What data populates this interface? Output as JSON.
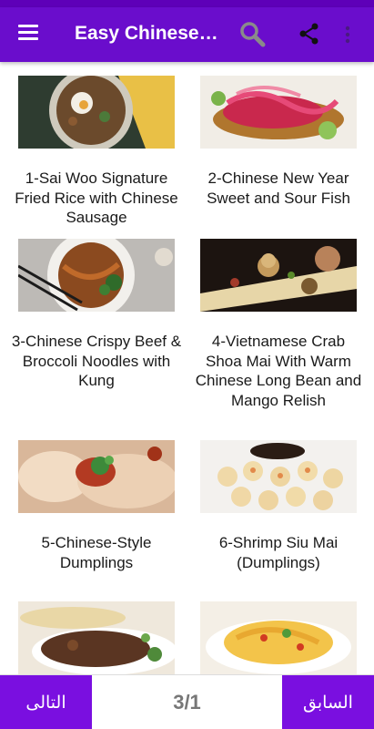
{
  "appbar": {
    "title": "Easy Chinese Recipes",
    "icons": [
      "menu-icon",
      "search-icon",
      "share-icon",
      "more-vert-icon"
    ],
    "color": "#6a0dcc"
  },
  "recipes": [
    {
      "caption": "1-Sai Woo Signature Fried Rice with Chinese Sausage"
    },
    {
      "caption": "2-Chinese New Year Sweet and Sour Fish"
    },
    {
      "caption": "3-Chinese Crispy Beef & Broccoli Noodles with Kung"
    },
    {
      "caption": "4-Vietnamese Crab Shoa Mai With Warm Chinese Long Bean and Mango Relish"
    },
    {
      "caption": "5-Chinese-Style Dumplings"
    },
    {
      "caption": "6-Shrimp Siu Mai (Dumplings)"
    }
  ],
  "bottom": {
    "next_label": "التالى",
    "prev_label": "السابق",
    "page_indicator": "3/1",
    "button_color": "#7a0fe0"
  }
}
